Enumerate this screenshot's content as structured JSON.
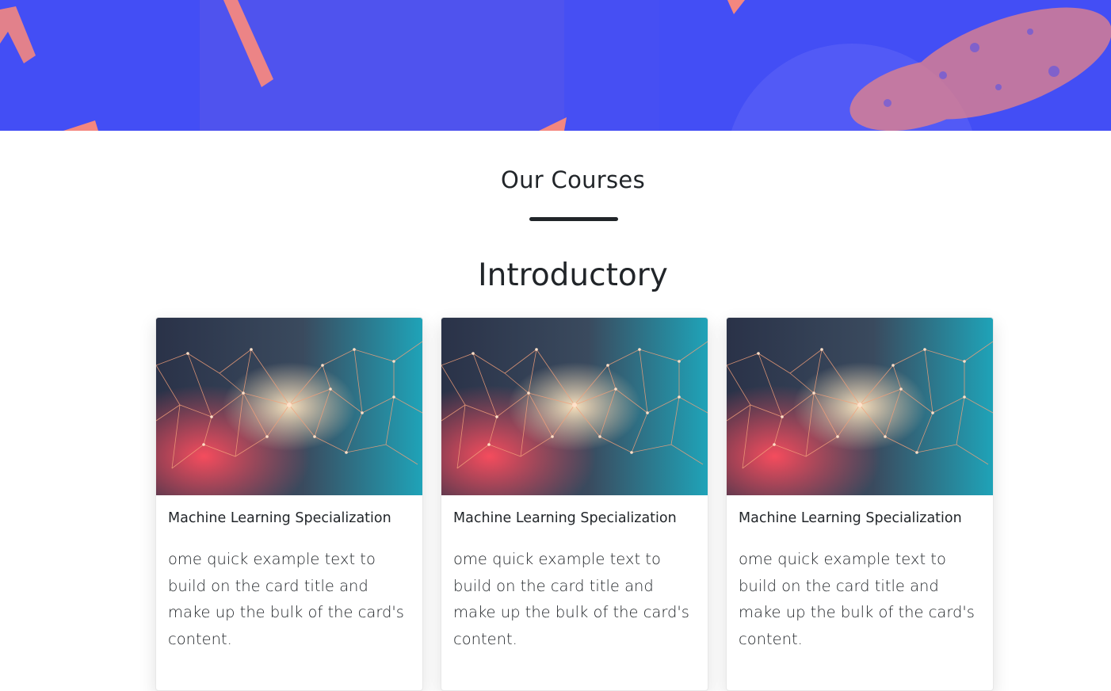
{
  "section": {
    "title": "Our Courses",
    "subtitle": "Introductory"
  },
  "colors": {
    "hero_background": "#434ef5",
    "hero_accent": "#f4877f",
    "underline": "#212529"
  },
  "cards": [
    {
      "title": "Machine Learning Specialization",
      "text": "ome quick example text to build on the card title and make up the bulk of the card's content.",
      "image": "network-nodes-image"
    },
    {
      "title": "Machine Learning Specialization",
      "text": "ome quick example text to build on the card title and make up the bulk of the card's content.",
      "image": "network-nodes-image"
    },
    {
      "title": "Machine Learning Specialization",
      "text": "ome quick example text to build on the card title and make up the bulk of the card's content.",
      "image": "network-nodes-image"
    }
  ]
}
